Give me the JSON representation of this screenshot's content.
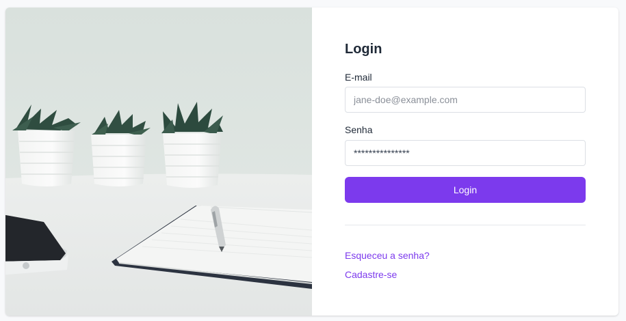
{
  "login": {
    "title": "Login",
    "email_label": "E-mail",
    "email_placeholder": "jane-doe@example.com",
    "password_label": "Senha",
    "password_value": "***************",
    "submit_label": "Login",
    "forgot_link": "Esqueceu a senha?",
    "signup_link": "Cadastre-se"
  },
  "theme": {
    "accent": "#7c3aed",
    "page_background": "#f8f9fb"
  }
}
